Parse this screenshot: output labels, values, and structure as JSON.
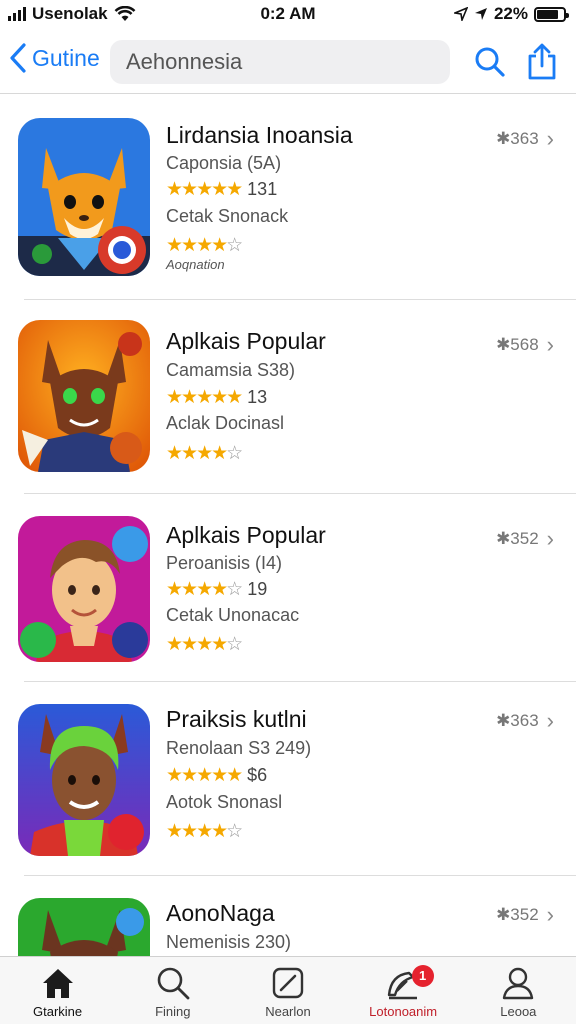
{
  "status_bar": {
    "carrier": "Usenolak",
    "time": "0:2 AM",
    "battery": "22%",
    "battery_level": 0.8
  },
  "nav": {
    "back_label": "Gutine",
    "search_value": "Aehonnesia"
  },
  "apps": [
    {
      "title": "Lirdansia Inoansia",
      "sub1": "Caponsia (5A)",
      "rating1": 5,
      "rating1_count": "131",
      "sub2": "Cetak Snonack",
      "rating2": 3.5,
      "note": "Aoqnation",
      "price": "✱363",
      "icon": "fox-character-icon",
      "colors": {
        "bg": "#2b78e0",
        "accent": "#f29a1c"
      }
    },
    {
      "title": "Aplkais Popular",
      "sub1": "Camamsia S38)",
      "rating1": 4.5,
      "rating1_count": "13",
      "sub2": "Aclak Docinasl",
      "rating2": 4,
      "note": "",
      "price": "✱568",
      "icon": "wolf-character-icon",
      "colors": {
        "bg": "#f07a10",
        "accent": "#7a3a1c"
      }
    },
    {
      "title": "Aplkais Popular",
      "sub1": "Peroanisis (I4)",
      "rating1": 4,
      "rating1_count": "19",
      "sub2": "Cetak Unonacac",
      "rating2": 4,
      "note": "",
      "price": "✱352",
      "icon": "boy-character-icon",
      "colors": {
        "bg": "#c21a9a",
        "accent": "#f2c18a"
      }
    },
    {
      "title": "Praiksis kutlni",
      "sub1": "Renolaan S3 249)",
      "rating1": 5,
      "rating1_count": "$6",
      "sub2": "Aotok Snonasl",
      "rating2": 4,
      "note": "",
      "price": "✱363",
      "icon": "man-character-icon",
      "colors": {
        "bg": "#5a3ac8",
        "accent": "#6ad23c"
      }
    },
    {
      "title": "AonoNaga",
      "sub1": "Nemenisis 230)",
      "rating1": 0,
      "rating1_count": "",
      "sub2": "",
      "rating2": 0,
      "note": "",
      "price": "✱352",
      "icon": "wolf-character-icon",
      "colors": {
        "bg": "#2ba82e",
        "accent": "#6b3520"
      }
    }
  ],
  "tabbar": {
    "tabs": [
      {
        "label": "Gtarkine",
        "icon": "home-icon"
      },
      {
        "label": "Fining",
        "icon": "search-icon"
      },
      {
        "label": "Nearlon",
        "icon": "edit-icon"
      },
      {
        "label": "Lotonoanim",
        "icon": "updates-icon",
        "badge": "1"
      },
      {
        "label": "Leooa",
        "icon": "profile-icon"
      }
    ]
  }
}
